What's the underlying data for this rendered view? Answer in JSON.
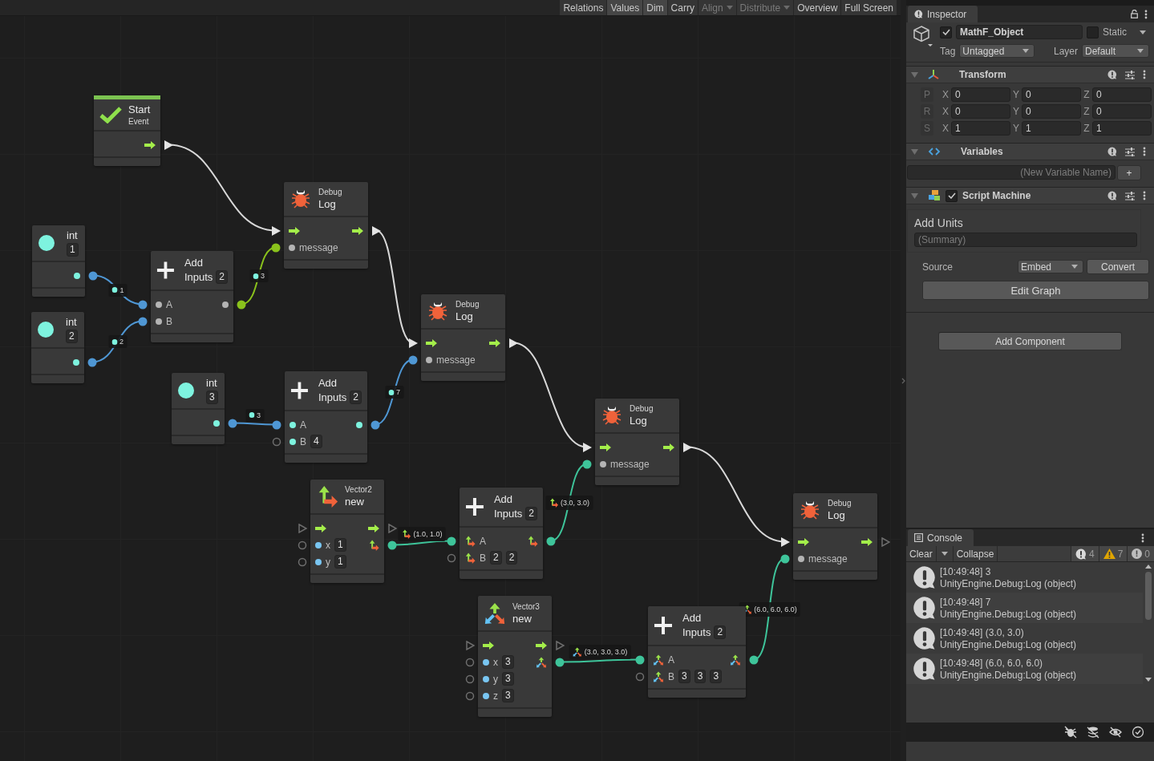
{
  "toolbar": {
    "buttons": [
      {
        "label": "Relations",
        "selected": false,
        "disabled": false,
        "dropdown": false
      },
      {
        "label": "Values",
        "selected": true,
        "disabled": false,
        "dropdown": false
      },
      {
        "label": "Dim",
        "selected": true,
        "disabled": false,
        "dropdown": false
      },
      {
        "label": "Carry",
        "selected": false,
        "disabled": false,
        "dropdown": false
      },
      {
        "label": "Align",
        "selected": false,
        "disabled": true,
        "dropdown": true
      },
      {
        "label": "Distribute",
        "selected": false,
        "disabled": true,
        "dropdown": true
      },
      {
        "label": "Overview",
        "selected": false,
        "disabled": false,
        "dropdown": false
      },
      {
        "label": "Full Screen",
        "selected": false,
        "disabled": false,
        "dropdown": false
      }
    ]
  },
  "graph": {
    "nodes": [
      {
        "kind": "event",
        "title": "Start",
        "subtitle": "Event",
        "rows": [
          {
            "out": {
              "kind": "flow",
              "connected": true
            }
          }
        ]
      },
      {
        "kind": "literal",
        "title": "int",
        "value": "1",
        "rows": [
          {
            "out": {
              "kind": "int",
              "connected": true
            }
          }
        ]
      },
      {
        "kind": "literal",
        "title": "int",
        "value": "2",
        "rows": [
          {
            "out": {
              "kind": "int",
              "connected": true
            }
          }
        ]
      },
      {
        "kind": "add",
        "title": "Add",
        "subtitle": "Inputs",
        "value": "2",
        "rows": [
          {
            "in": {
              "kind": "any",
              "label": "A",
              "connected": true
            },
            "out": {
              "kind": "any",
              "connected": true
            }
          },
          {
            "in": {
              "kind": "any",
              "label": "B",
              "connected": true
            }
          }
        ]
      },
      {
        "kind": "literal",
        "title": "int",
        "value": "3",
        "rows": [
          {
            "out": {
              "kind": "int",
              "connected": true
            }
          }
        ]
      },
      {
        "kind": "debug",
        "title": "Debug",
        "subtitle": "Log",
        "rows": [
          {
            "in": {
              "kind": "flow",
              "connected": true
            },
            "out": {
              "kind": "flow",
              "connected": true
            }
          },
          {
            "in": {
              "kind": "any",
              "label": "message",
              "connected": true
            }
          }
        ]
      },
      {
        "kind": "add",
        "title": "Add",
        "subtitle": "Inputs",
        "value": "2",
        "rows": [
          {
            "in": {
              "kind": "int",
              "label": "A",
              "connected": true
            },
            "out": {
              "kind": "int",
              "connected": true
            }
          },
          {
            "in": {
              "kind": "int",
              "label": "B",
              "values": [
                "4"
              ],
              "connected": false
            }
          }
        ]
      },
      {
        "kind": "vector2",
        "title": "Vector2",
        "subtitle": "new",
        "rows": [
          {
            "in": {
              "kind": "flow",
              "connected": false
            },
            "out": {
              "kind": "flow",
              "connected": false
            }
          },
          {
            "in": {
              "kind": "float",
              "label": "x",
              "values": [
                "1"
              ],
              "connected": false
            },
            "out": {
              "kind": "vector2",
              "connected": true
            }
          },
          {
            "in": {
              "kind": "float",
              "label": "y",
              "values": [
                "1"
              ],
              "connected": false
            }
          }
        ]
      },
      {
        "kind": "debug",
        "title": "Debug",
        "subtitle": "Log",
        "rows": [
          {
            "in": {
              "kind": "flow",
              "connected": true
            },
            "out": {
              "kind": "flow",
              "connected": true
            }
          },
          {
            "in": {
              "kind": "any",
              "label": "message",
              "connected": true
            }
          }
        ]
      },
      {
        "kind": "add",
        "title": "Add",
        "subtitle": "Inputs",
        "value": "2",
        "rows": [
          {
            "in": {
              "kind": "vector2",
              "label": "A",
              "connected": true
            },
            "out": {
              "kind": "vector2",
              "connected": true
            }
          },
          {
            "in": {
              "kind": "vector2",
              "label": "B",
              "values": [
                "2",
                "2"
              ],
              "connected": false
            }
          }
        ]
      },
      {
        "kind": "vector3",
        "title": "Vector3",
        "subtitle": "new",
        "rows": [
          {
            "in": {
              "kind": "flow",
              "connected": false
            },
            "out": {
              "kind": "flow",
              "connected": false
            }
          },
          {
            "in": {
              "kind": "float",
              "label": "x",
              "values": [
                "3"
              ],
              "connected": false
            },
            "out": {
              "kind": "vector3",
              "connected": true
            }
          },
          {
            "in": {
              "kind": "float",
              "label": "y",
              "values": [
                "3"
              ],
              "connected": false
            }
          },
          {
            "in": {
              "kind": "float",
              "label": "z",
              "values": [
                "3"
              ],
              "connected": false
            }
          }
        ]
      },
      {
        "kind": "debug",
        "title": "Debug",
        "subtitle": "Log",
        "rows": [
          {
            "in": {
              "kind": "flow",
              "connected": true
            },
            "out": {
              "kind": "flow",
              "connected": true
            }
          },
          {
            "in": {
              "kind": "any",
              "label": "message",
              "connected": true
            }
          }
        ]
      },
      {
        "kind": "add",
        "title": "Add",
        "subtitle": "Inputs",
        "value": "2",
        "rows": [
          {
            "in": {
              "kind": "vector3",
              "label": "A",
              "connected": true
            },
            "out": {
              "kind": "vector3",
              "connected": true
            }
          },
          {
            "in": {
              "kind": "vector3",
              "label": "B",
              "values": [
                "3",
                "3",
                "3"
              ],
              "connected": false
            }
          }
        ]
      },
      {
        "kind": "debug",
        "title": "Debug",
        "subtitle": "Log",
        "rows": [
          {
            "in": {
              "kind": "flow",
              "connected": true
            },
            "out": {
              "kind": "flow",
              "connected": false
            }
          },
          {
            "in": {
              "kind": "any",
              "label": "message",
              "connected": true
            }
          }
        ]
      }
    ],
    "connections": [
      {
        "kind": "flow"
      },
      {
        "kind": "int",
        "label": "1"
      },
      {
        "kind": "int",
        "label": "2"
      },
      {
        "kind": "number",
        "label": "3"
      },
      {
        "kind": "flow"
      },
      {
        "kind": "int",
        "label": "3"
      },
      {
        "kind": "int",
        "label": "7"
      },
      {
        "kind": "flow"
      },
      {
        "kind": "vector2",
        "label": "(1.0, 1.0)"
      },
      {
        "kind": "vector2",
        "label": "(3.0, 3.0)"
      },
      {
        "kind": "flow"
      },
      {
        "kind": "vector3",
        "label": "(3.0, 3.0, 3.0)"
      },
      {
        "kind": "vector3",
        "label": "(6.0, 6.0, 6.0)"
      }
    ]
  },
  "inspector": {
    "tab": "Inspector",
    "object": {
      "active": true,
      "name": "MathF_Object",
      "static": false,
      "static_label": "Static",
      "tag_label": "Tag",
      "tag": "Untagged",
      "layer_label": "Layer",
      "layer": "Default"
    },
    "components": [
      {
        "kind": "transform",
        "title": "Transform",
        "expanded": true,
        "rows": [
          {
            "label": "P",
            "fields": [
              {
                "axis": "X",
                "value": "0"
              },
              {
                "axis": "Y",
                "value": "0"
              },
              {
                "axis": "Z",
                "value": "0"
              }
            ]
          },
          {
            "label": "R",
            "fields": [
              {
                "axis": "X",
                "value": "0"
              },
              {
                "axis": "Y",
                "value": "0"
              },
              {
                "axis": "Z",
                "value": "0"
              }
            ]
          },
          {
            "label": "S",
            "fields": [
              {
                "axis": "X",
                "value": "1"
              },
              {
                "axis": "Y",
                "value": "1"
              },
              {
                "axis": "Z",
                "value": "1"
              }
            ]
          }
        ]
      },
      {
        "kind": "variables",
        "title": "Variables",
        "expanded": true,
        "placeholder": "(New Variable Name)",
        "add_label": "+"
      },
      {
        "kind": "script_machine",
        "title": "Script Machine",
        "expanded": true,
        "enabled": true,
        "graph_title": "Add Units",
        "summary_placeholder": "(Summary)",
        "source_label": "Source",
        "source": "Embed",
        "convert": "Convert",
        "edit": "Edit Graph"
      }
    ],
    "add_component": "Add Component"
  },
  "console": {
    "tab": "Console",
    "clear": "Clear",
    "collapse": "Collapse",
    "counts": [
      {
        "kind": "info",
        "count": "4"
      },
      {
        "kind": "warning",
        "count": "7"
      },
      {
        "kind": "error",
        "count": "0"
      }
    ],
    "entries": [
      {
        "message": "[10:49:48] 3",
        "trace": "UnityEngine.Debug:Log (object)"
      },
      {
        "message": "[10:49:48] 7",
        "trace": "UnityEngine.Debug:Log (object)"
      },
      {
        "message": "[10:49:48] (3.0, 3.0)",
        "trace": "UnityEngine.Debug:Log (object)"
      },
      {
        "message": "[10:49:48] (6.0, 6.0, 6.0)",
        "trace": "UnityEngine.Debug:Log (object)"
      }
    ]
  }
}
